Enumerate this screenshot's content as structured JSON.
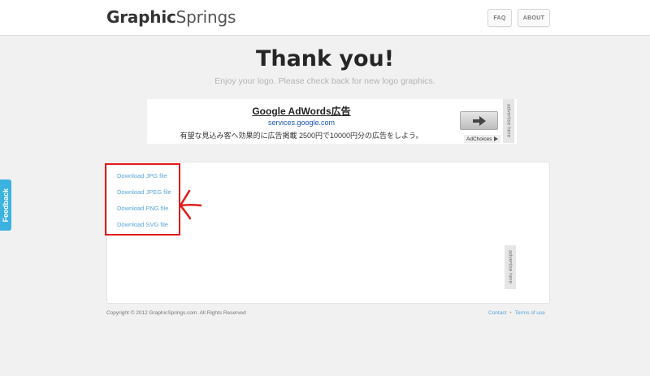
{
  "header": {
    "logo_bold": "Graphic",
    "logo_light": "Springs",
    "nav": {
      "faq": "FAQ",
      "about": "ABOUT"
    }
  },
  "main": {
    "title": "Thank you!",
    "subtitle": "Enjoy your logo. Please check back for new logo graphics."
  },
  "ad": {
    "title": "Google AdWords広告",
    "url": "services.google.com",
    "description": "有望な見込み客へ効果的に広告掲載 2500円で10000円分の広告をしよう。",
    "adchoices": "AdChoices",
    "side_label": "advertise here",
    "arrow_icon": "arrow-right-icon"
  },
  "downloads": [
    "Download JPG file",
    "Download JPEG file",
    "Download PNG file",
    "Download SVG file"
  ],
  "panel": {
    "side_label": "advertise here"
  },
  "footer": {
    "copyright": "Copyright © 2012 GraphicSprings.com. All Rights Reserved",
    "contact": "Contact",
    "separator": "•",
    "terms": "Terms of use"
  },
  "feedback": {
    "label": "Feedback"
  },
  "colors": {
    "accent": "#3bb2e0",
    "link": "#5ba5d8",
    "annotation": "#e21a1a"
  }
}
